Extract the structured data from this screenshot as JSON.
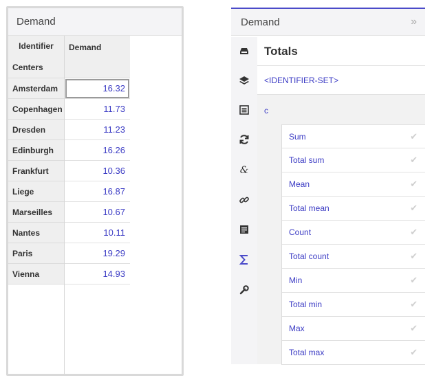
{
  "left_panel": {
    "title": "Demand",
    "identifier_header": "Identifier",
    "index_header": "Centers",
    "value_header": "Demand",
    "rows": [
      {
        "center": "Amsterdam",
        "value": "16.32"
      },
      {
        "center": "Copenhagen",
        "value": "11.73"
      },
      {
        "center": "Dresden",
        "value": "11.23"
      },
      {
        "center": "Edinburgh",
        "value": "16.26"
      },
      {
        "center": "Frankfurt",
        "value": "10.36"
      },
      {
        "center": "Liege",
        "value": "16.87"
      },
      {
        "center": "Marseilles",
        "value": "10.67"
      },
      {
        "center": "Nantes",
        "value": "10.11"
      },
      {
        "center": "Paris",
        "value": "19.29"
      },
      {
        "center": "Vienna",
        "value": "14.93"
      }
    ]
  },
  "right_panel": {
    "title": "Demand",
    "collapse_glyph": "»",
    "section_title": "Totals",
    "identifier_set": "<IDENTIFIER-SET>",
    "index_label": "c",
    "options": [
      {
        "label": "Sum"
      },
      {
        "label": "Total sum"
      },
      {
        "label": "Mean"
      },
      {
        "label": "Total mean"
      },
      {
        "label": "Count"
      },
      {
        "label": "Total count"
      },
      {
        "label": "Min"
      },
      {
        "label": "Total min"
      },
      {
        "label": "Max"
      },
      {
        "label": "Total max"
      }
    ],
    "check_glyph": "✔",
    "icons": [
      "inbox-icon",
      "layers-icon",
      "document-icon",
      "refresh-icon",
      "ampersand-icon",
      "link-icon",
      "newspaper-icon",
      "sigma-icon",
      "wrench-icon"
    ]
  },
  "colors": {
    "accent": "#4b4bc9",
    "value_text": "#3b3bc4",
    "header_bg": "#f4f4f6"
  }
}
